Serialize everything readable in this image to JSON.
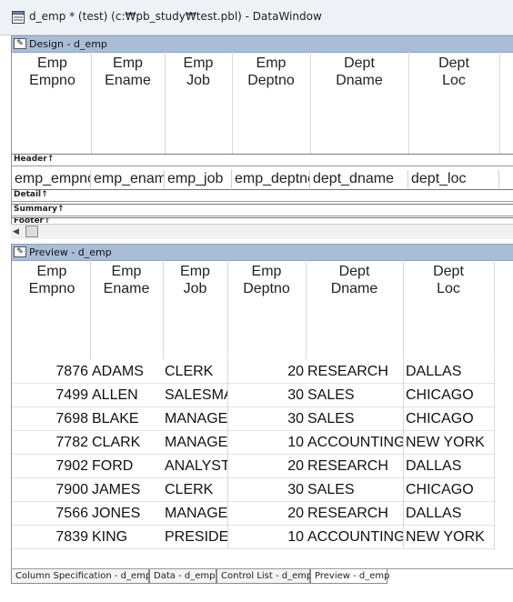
{
  "window": {
    "title": "d_emp * (test) (c:₩pb_study₩test.pbl) - DataWindow"
  },
  "design": {
    "panel_title": "Design - d_emp",
    "headers": [
      [
        "Emp",
        "Empno"
      ],
      [
        "Emp",
        "Ename"
      ],
      [
        "Emp",
        "Job"
      ],
      [
        "Emp",
        "Deptno"
      ],
      [
        "Dept",
        "Dname"
      ],
      [
        "Dept",
        "Loc"
      ]
    ],
    "bands": {
      "header": "Header↑",
      "detail": "Detail↑",
      "summary": "Summary↑",
      "footer": "Footer↑"
    },
    "detail_columns": [
      "emp_empno",
      "emp_ename",
      "emp_job",
      "emp_deptno",
      "dept_dname",
      "dept_loc"
    ]
  },
  "preview": {
    "panel_title": "Preview - d_emp",
    "headers": [
      [
        "Emp",
        "Empno"
      ],
      [
        "Emp",
        "Ename"
      ],
      [
        "Emp",
        "Job"
      ],
      [
        "Emp",
        "Deptno"
      ],
      [
        "Dept",
        "Dname"
      ],
      [
        "Dept",
        "Loc"
      ]
    ],
    "rows": [
      [
        "7876",
        "ADAMS",
        "CLERK",
        "20",
        "RESEARCH",
        "DALLAS"
      ],
      [
        "7499",
        "ALLEN",
        "SALESMAN",
        "30",
        "SALES",
        "CHICAGO"
      ],
      [
        "7698",
        "BLAKE",
        "MANAGER",
        "30",
        "SALES",
        "CHICAGO"
      ],
      [
        "7782",
        "CLARK",
        "MANAGER",
        "10",
        "ACCOUNTING",
        "NEW YORK"
      ],
      [
        "7902",
        "FORD",
        "ANALYST",
        "20",
        "RESEARCH",
        "DALLAS"
      ],
      [
        "7900",
        "JAMES",
        "CLERK",
        "30",
        "SALES",
        "CHICAGO"
      ],
      [
        "7566",
        "JONES",
        "MANAGER",
        "20",
        "RESEARCH",
        "DALLAS"
      ],
      [
        "7839",
        "KING",
        "PRESIDENT",
        "10",
        "ACCOUNTING",
        "NEW YORK"
      ]
    ]
  },
  "tabs": [
    "Column Specification - d_emp",
    "Data - d_emp",
    "Control List - d_emp",
    "Preview - d_emp"
  ],
  "active_tab": 3,
  "icons": {
    "window_icon": "datawindow-icon",
    "panel_icon": "datawindow-panel-icon"
  }
}
